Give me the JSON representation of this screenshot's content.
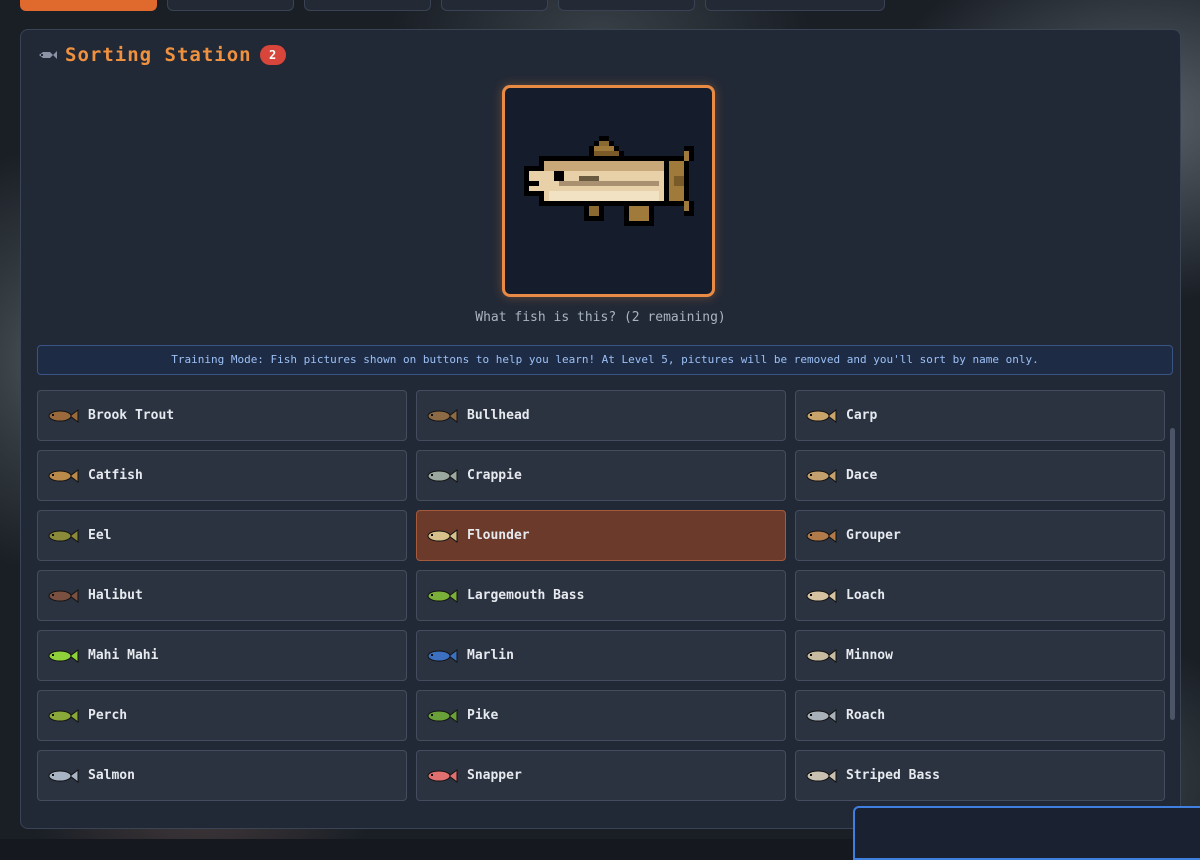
{
  "panel": {
    "title": "Sorting Station",
    "badge": "2",
    "prompt": "What fish is this? (2 remaining)",
    "training_text": "Training Mode: Fish pictures shown on buttons to help you learn! At Level 5, pictures will be removed and you'll sort by name only."
  },
  "current_fish": {
    "icon": "catfish-pixel-icon"
  },
  "fish_options": [
    {
      "label": "Brook Trout",
      "icon": "brook-trout-icon",
      "color": "#9a6a3c"
    },
    {
      "label": "Bullhead",
      "icon": "bullhead-icon",
      "color": "#8b6a45"
    },
    {
      "label": "Carp",
      "icon": "carp-icon",
      "color": "#c9a46a"
    },
    {
      "label": "Catfish",
      "icon": "catfish-icon",
      "color": "#b98a4a"
    },
    {
      "label": "Crappie",
      "icon": "crappie-icon",
      "color": "#9aa8a0"
    },
    {
      "label": "Dace",
      "icon": "dace-icon",
      "color": "#c4a06e"
    },
    {
      "label": "Eel",
      "icon": "eel-icon",
      "color": "#8a8a3a"
    },
    {
      "label": "Flounder",
      "icon": "flounder-icon",
      "color": "#d8c08a",
      "selected": true
    },
    {
      "label": "Grouper",
      "icon": "grouper-icon",
      "color": "#b07a4a"
    },
    {
      "label": "Halibut",
      "icon": "halibut-icon",
      "color": "#7a5040"
    },
    {
      "label": "Largemouth Bass",
      "icon": "largemouth-bass-icon",
      "color": "#7ab03a"
    },
    {
      "label": "Loach",
      "icon": "loach-icon",
      "color": "#d6c2a0"
    },
    {
      "label": "Mahi Mahi",
      "icon": "mahi-mahi-icon",
      "color": "#8fd13a"
    },
    {
      "label": "Marlin",
      "icon": "marlin-icon",
      "color": "#3d6fc0"
    },
    {
      "label": "Minnow",
      "icon": "minnow-icon",
      "color": "#c8bca0"
    },
    {
      "label": "Perch",
      "icon": "perch-icon",
      "color": "#8aa83a"
    },
    {
      "label": "Pike",
      "icon": "pike-icon",
      "color": "#6aa03a"
    },
    {
      "label": "Roach",
      "icon": "roach-icon",
      "color": "#a8b0b8"
    },
    {
      "label": "Salmon",
      "icon": "salmon-icon",
      "color": "#a8b4c4"
    },
    {
      "label": "Snapper",
      "icon": "snapper-icon",
      "color": "#e07070"
    },
    {
      "label": "Striped Bass",
      "icon": "striped-bass-icon",
      "color": "#c8c0b0"
    }
  ],
  "colors": {
    "accent": "#f0913f",
    "selected": "#6b3a2a",
    "badge": "#d8453a"
  }
}
